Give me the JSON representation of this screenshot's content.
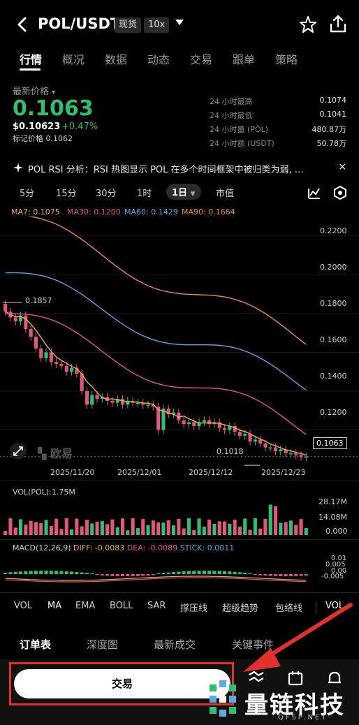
{
  "header": {
    "pair": "POL/USDT",
    "spot_tag": "现货",
    "leverage_tag": "10x"
  },
  "tabs": [
    "行情",
    "概况",
    "数据",
    "动态",
    "交易",
    "跟单",
    "策略"
  ],
  "price": {
    "latest_label": "最新价格",
    "latest_caret": "▾",
    "last": "0.1063",
    "usd": "$0.10623",
    "change": "+0.47%",
    "mark": "标记价格 0.1062"
  },
  "stats": [
    {
      "label": "24 小时最高",
      "value": "0.1074"
    },
    {
      "label": "24 小时最低",
      "value": "0.1041"
    },
    {
      "label": "24 小时量 (POL)",
      "value": "480.87万"
    },
    {
      "label": "24 小时额 (USDT)",
      "value": "50.78万"
    }
  ],
  "news": "POL RSI 分析：RSI 热图显示 POL 在多个时间框架中被归类为弱, …",
  "news_close": "×",
  "intervals": [
    "5分",
    "15分",
    "30分",
    "1时",
    "1日",
    "市值"
  ],
  "active_interval": "1日",
  "ma_legend": [
    {
      "text": "MA7: 0.1075",
      "color": "#e8b04b"
    },
    {
      "text": "MA30: 0.1200",
      "color": "#e0577d"
    },
    {
      "text": "MA60: 0.1429",
      "color": "#5fa8e0"
    },
    {
      "text": "MA90: 0.1664",
      "color": "#e88a4b"
    }
  ],
  "price_axis": [
    "0.2200",
    "0.2000",
    "0.1800",
    "0.1600",
    "0.1400",
    "0.1200"
  ],
  "date_axis": [
    "2025/11/20",
    "2025/12/01",
    "2025/12/12",
    "2025/12/23"
  ],
  "high_marker": "0.1857",
  "low_marker": "0.1018",
  "current_price_tag": "0.1063",
  "watermark": "欧易",
  "volume": {
    "label": "VOL(POL):1.75M",
    "axis": [
      "28.17M",
      "14.08M",
      "0.000"
    ]
  },
  "macd": {
    "label": "MACD(12,26,9)",
    "diff": "DIFF: -0.0083",
    "dea": "DEA: -0.0089",
    "stick": "STICK: 0.0011",
    "axis": [
      "0.01",
      "0.005",
      "0.00",
      "-0.005"
    ],
    "colors": {
      "diff": "#e8b04b",
      "dea": "#e0577d",
      "stick": "#5fa8e0"
    }
  },
  "indicators": [
    "VOL",
    "MA",
    "EMA",
    "BOLL",
    "SAR",
    "撑压线",
    "超级趋势",
    "包络线",
    "VOL"
  ],
  "active_indicator": "MA",
  "book_tabs": [
    "订单表",
    "深度图",
    "最新成交",
    "关键事件"
  ],
  "trade_button": "交易",
  "brand": "量链科技",
  "brand_url": "QFSP.NET",
  "colors": {
    "up": "#2fbf71",
    "down": "#e0577d",
    "accent_red": "#e0312c"
  },
  "chart_data": {
    "type": "candlestick",
    "x_range": [
      "2025/11/12",
      "2025/12/27"
    ],
    "ylim": [
      0.095,
      0.23
    ],
    "closes": [
      0.181,
      0.178,
      0.176,
      0.179,
      0.172,
      0.168,
      0.162,
      0.157,
      0.16,
      0.155,
      0.154,
      0.153,
      0.15,
      0.152,
      0.149,
      0.14,
      0.133,
      0.138,
      0.136,
      0.137,
      0.135,
      0.134,
      0.136,
      0.133,
      0.135,
      0.134,
      0.134,
      0.133,
      0.133,
      0.132,
      0.12,
      0.131,
      0.128,
      0.129,
      0.125,
      0.123,
      0.124,
      0.122,
      0.124,
      0.125,
      0.123,
      0.124,
      0.121,
      0.12,
      0.122,
      0.119,
      0.117,
      0.118,
      0.114,
      0.115,
      0.113,
      0.111,
      0.111,
      0.109,
      0.11,
      0.108,
      0.108,
      0.107,
      0.106,
      0.1063
    ]
  }
}
